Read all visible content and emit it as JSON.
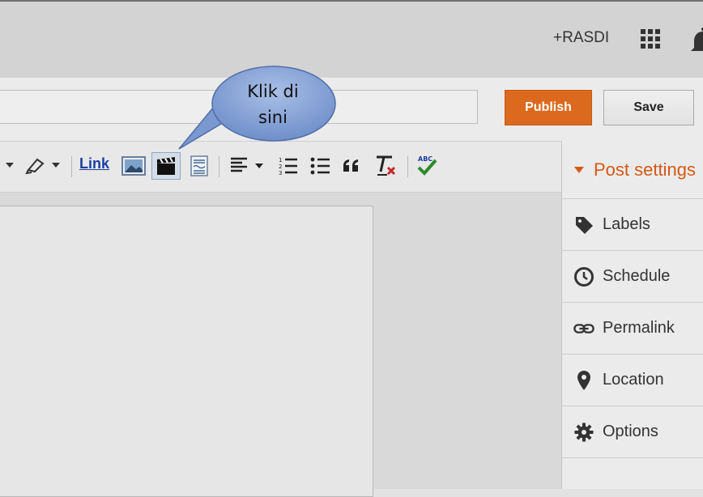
{
  "header": {
    "user_link": "+RASDI",
    "apps_icon": "apps-grid-icon",
    "notifications_icon": "bell-icon"
  },
  "post": {
    "title_placeholder": "",
    "publish_label": "Publish",
    "save_label": "Save"
  },
  "toolbar": {
    "link_label": "Link",
    "items": [
      "text-color-icon",
      "highlight-icon",
      "link",
      "insert-image-icon",
      "insert-video-icon",
      "jump-break-icon",
      "align-icon",
      "numbered-list-icon",
      "bullet-list-icon",
      "quote-icon",
      "remove-formatting-icon",
      "spellcheck-icon"
    ]
  },
  "callout": {
    "line1": "Klik di",
    "line2": "sini"
  },
  "sidebar": {
    "header": "Post settings",
    "items": [
      {
        "label": "Labels",
        "icon": "tag-icon"
      },
      {
        "label": "Schedule",
        "icon": "clock-icon"
      },
      {
        "label": "Permalink",
        "icon": "chain-link-icon"
      },
      {
        "label": "Location",
        "icon": "map-pin-icon"
      },
      {
        "label": "Options",
        "icon": "gear-icon"
      }
    ]
  },
  "colors": {
    "publish": "#db6a1f",
    "accent_text": "#d35a16",
    "link": "#1a3fa0",
    "callout": "#7b98d0"
  }
}
